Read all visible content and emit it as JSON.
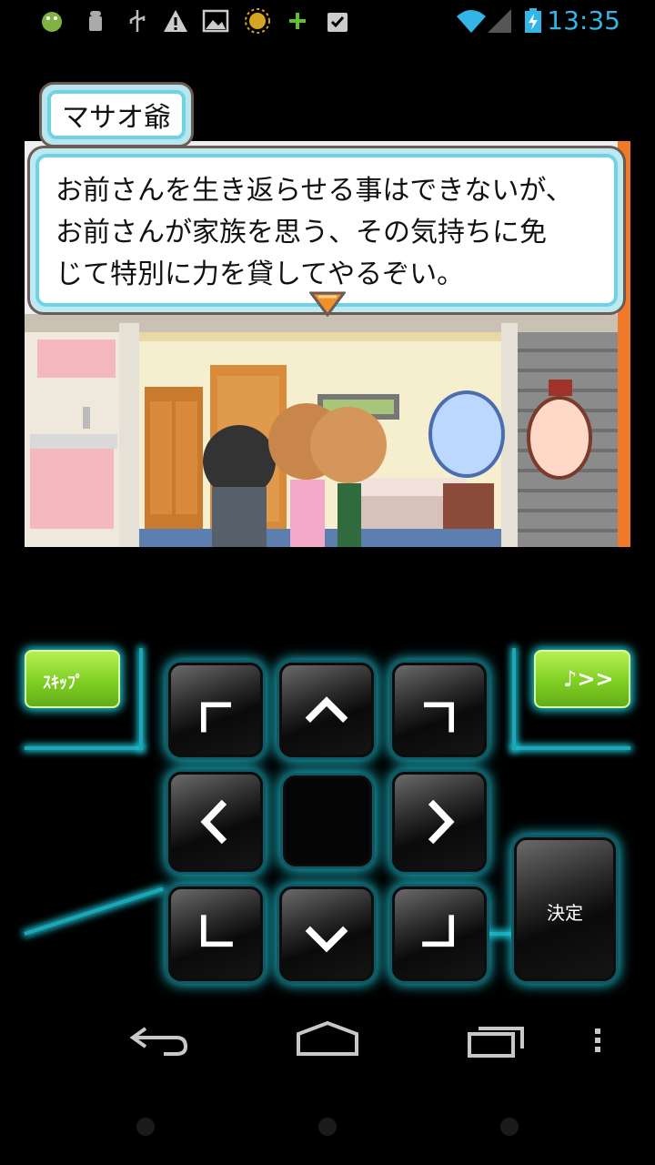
{
  "status_bar": {
    "time": "13:35",
    "icons": [
      "android-bug-icon",
      "android-robot-icon",
      "usb-icon",
      "warning-icon",
      "image-icon",
      "sun-badge-icon",
      "plus-icon",
      "clipboard-check-icon",
      "wifi-icon",
      "signal-icon",
      "battery-charging-icon"
    ]
  },
  "dialogue": {
    "speaker": "マサオ爺",
    "lines": [
      "お前さんを生き返らせる事はできないが、",
      "お前さんが家族を思う、その気持ちに免",
      "じて特別に力を貸してやるぞい。"
    ]
  },
  "controller": {
    "skip_label": "ｽｷｯﾌﾟ",
    "music_label": "♪>>",
    "confirm_label": "決定",
    "dpad": [
      "up-left",
      "up",
      "up-right",
      "left",
      "center",
      "right",
      "down-left",
      "down",
      "down-right"
    ]
  },
  "nav_bar": [
    "back-icon",
    "home-icon",
    "recent-apps-icon",
    "overflow-menu-icon"
  ],
  "colors": {
    "clock": "#33b5e5",
    "glow": "#1ec8d8",
    "green": "#7fcf24",
    "dialog_border": "#6fd3e6"
  }
}
